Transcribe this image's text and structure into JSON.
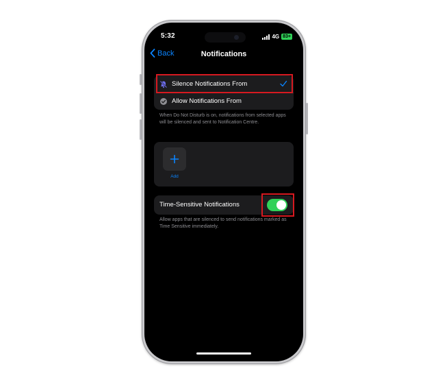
{
  "status_bar": {
    "time": "5:32",
    "network": "4G",
    "battery": "83+"
  },
  "nav": {
    "back_label": "Back",
    "title": "Notifications"
  },
  "mode_group": {
    "options": [
      {
        "label": "Silence Notifications From",
        "selected": true,
        "icon": "bell-slash-icon"
      },
      {
        "label": "Allow Notifications From",
        "selected": false,
        "icon": "check-badge-icon"
      }
    ],
    "footer": "When Do Not Disturb is on, notifications from selected apps will be silenced and sent to Notification Centre."
  },
  "apps_group": {
    "add_label": "Add",
    "icon": "plus-icon"
  },
  "time_sensitive": {
    "label": "Time-Sensitive Notifications",
    "enabled": true,
    "footer": "Allow apps that are silenced to send notifications marked as Time Sensitive immediately."
  },
  "colors": {
    "accent": "#0a84ff",
    "toggle_on": "#30d158",
    "highlight": "#d71920",
    "background": "#000000",
    "group_bg": "#1c1c1e"
  }
}
